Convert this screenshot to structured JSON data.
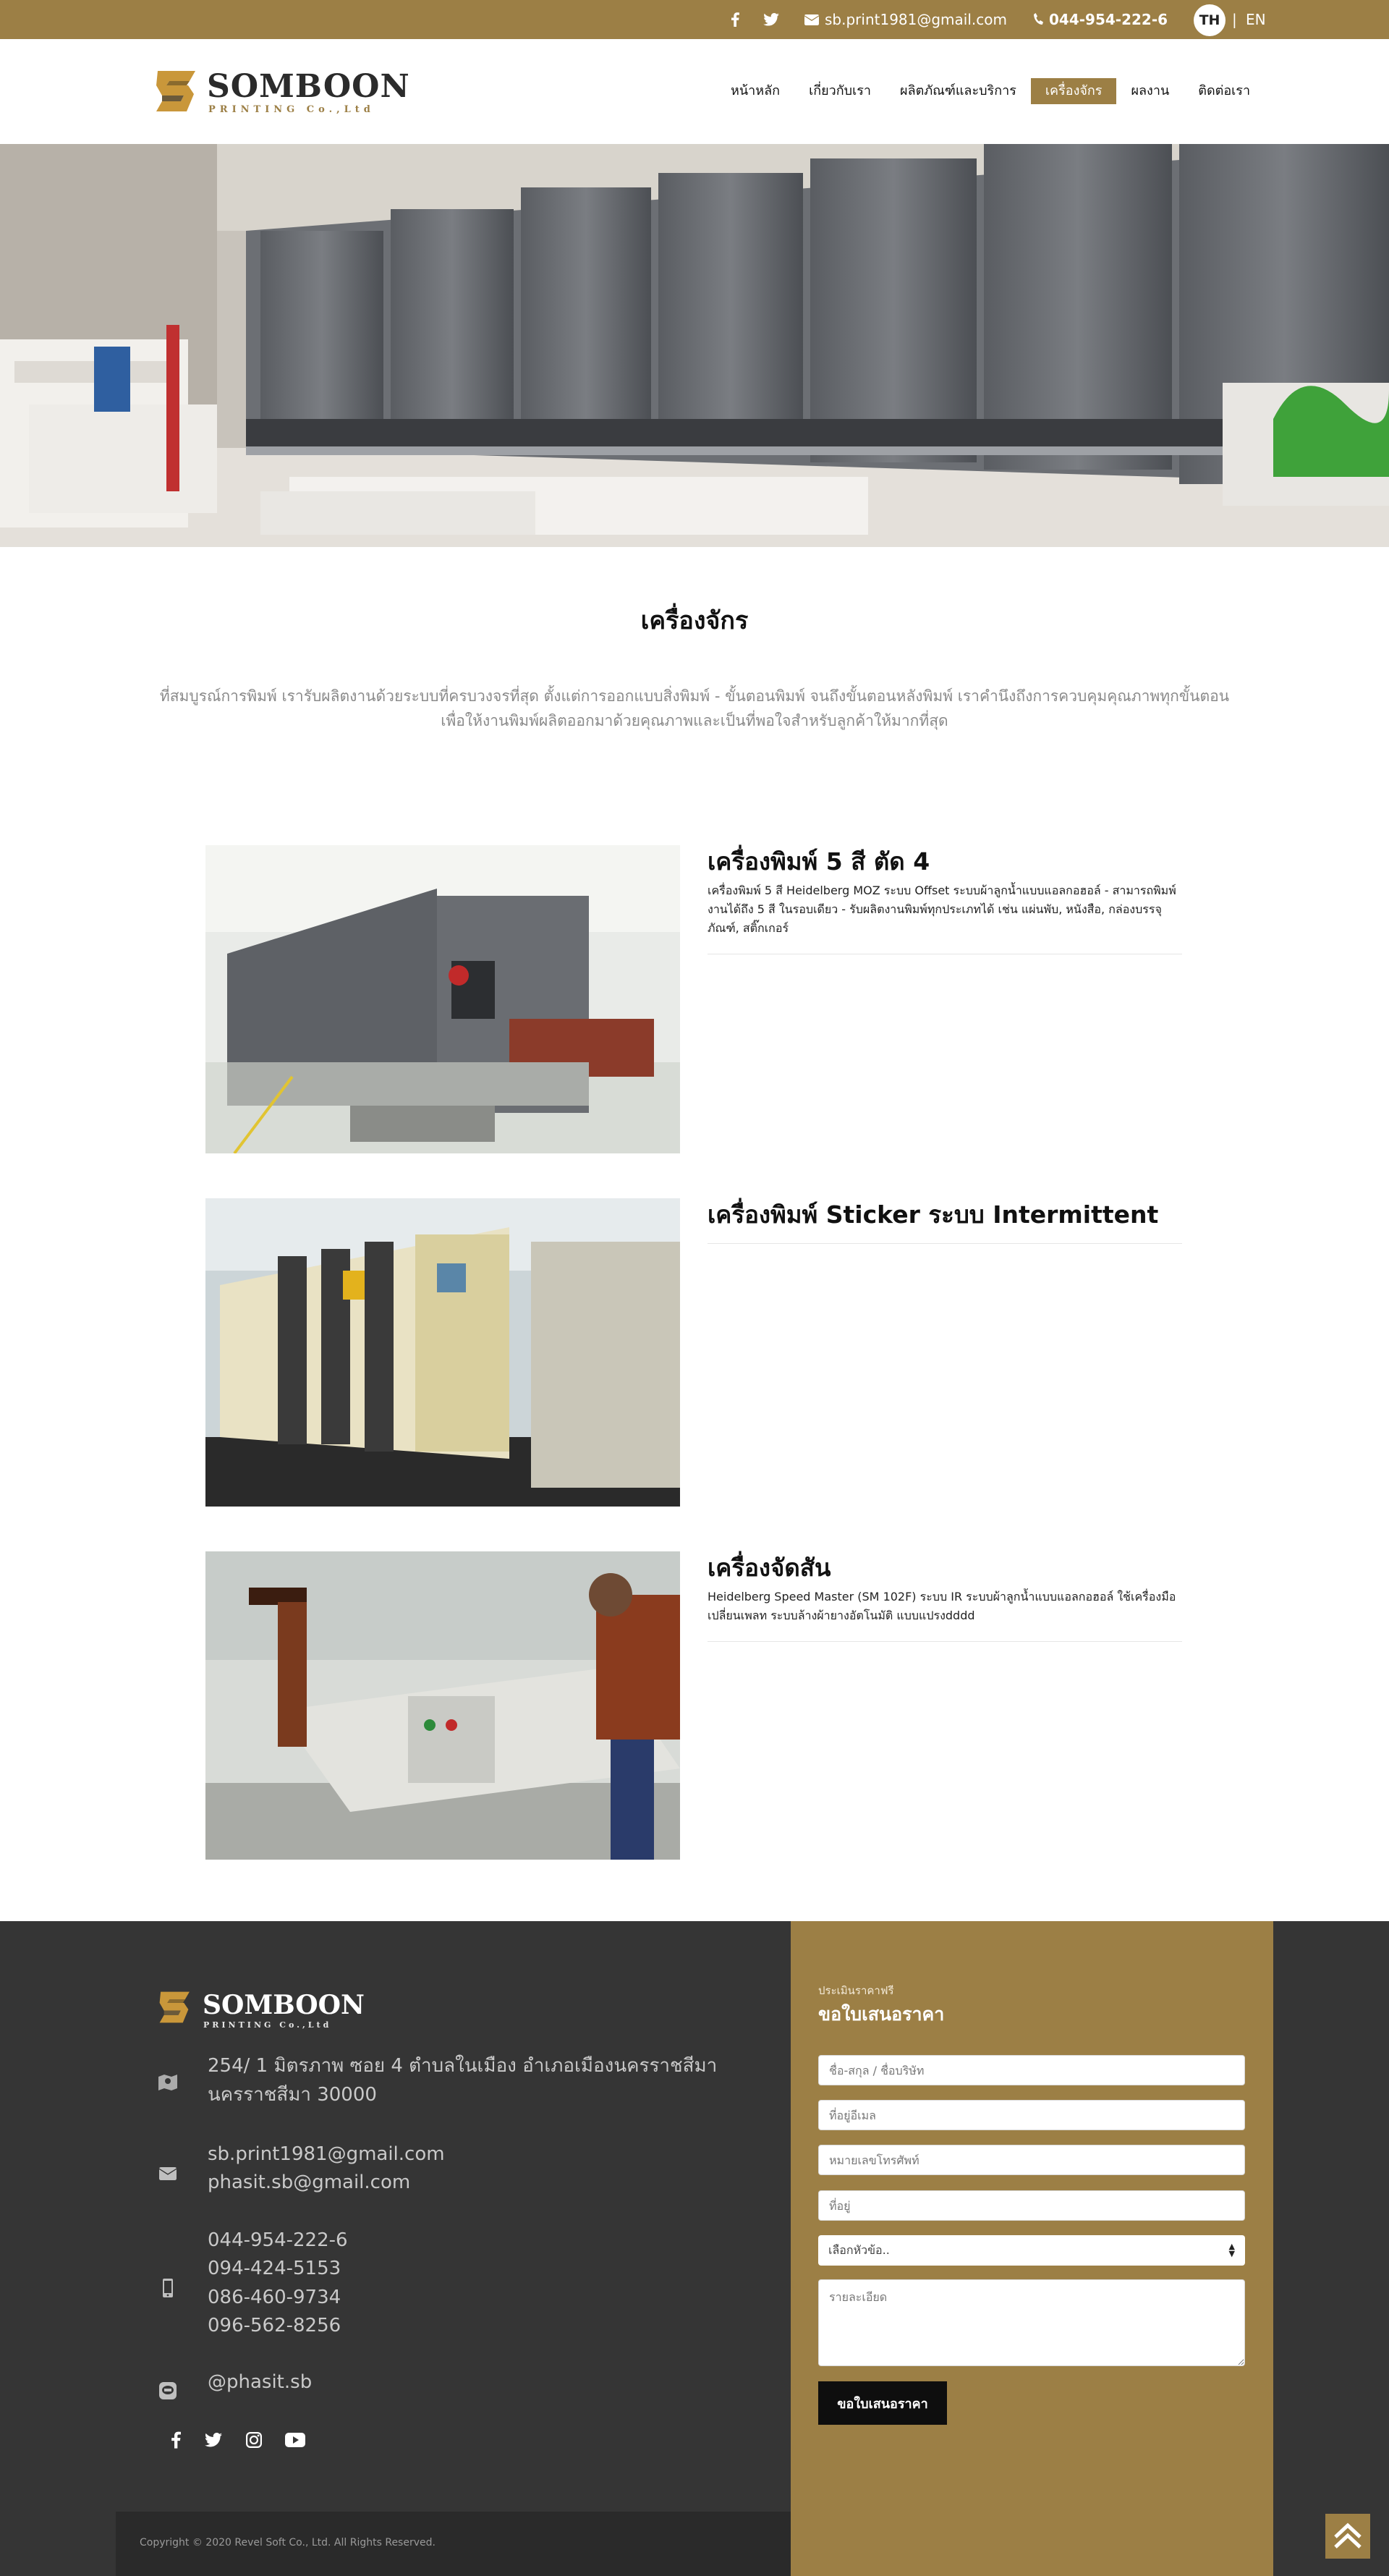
{
  "topbar": {
    "email": "sb.print1981@gmail.com",
    "phone": "044-954-222-6",
    "lang_th": "TH",
    "lang_sep": "|",
    "lang_en": "EN"
  },
  "brand": {
    "name": "SOMBOON",
    "sub": "PRINTING Co.,Ltd"
  },
  "nav": {
    "items": [
      {
        "label": "หน้าหลัก"
      },
      {
        "label": "เกี่ยวกับเรา"
      },
      {
        "label": "ผลิตภัณฑ์และบริการ"
      },
      {
        "label": "เครื่องจักร"
      },
      {
        "label": "ผลงาน"
      },
      {
        "label": "ติดต่อเรา"
      }
    ],
    "active": "เครื่องจักร"
  },
  "section": {
    "title": "เครื่องจักร",
    "description": "ที่สมบูรณ์การพิมพ์ เรารับผลิตงานด้วยระบบที่ครบวงจรที่สุด ตั้งแต่การออกแบบสิ่งพิมพ์ - ขั้นตอนพิมพ์ จนถึงขั้นตอนหลังพิมพ์ เราคำนึงถึงการควบคุมคุณภาพทุกขั้นตอนเพื่อให้งานพิมพ์ผลิตออกมาด้วยคุณภาพและเป็นที่พอใจสำหรับลูกค้าให้มากที่สุด"
  },
  "machines": [
    {
      "title": "เครื่องพิมพ์ 5 สี ตัด 4",
      "description": "เครื่องพิมพ์ 5 สี Heidelberg MOZ ระบบ Offset ระบบผ้าลูกน้ำแบบแอลกอฮอล์ - สามารถพิมพ์งานได้ถึง 5 สี ในรอบเดียว - รับผลิตงานพิมพ์ทุกประเภทได้ เช่น แผ่นพับ, หนังสือ, กล่องบรรจุภัณฑ์, สติ๊กเกอร์"
    },
    {
      "title": "เครื่องพิมพ์ Sticker ระบบ Intermittent",
      "description": ""
    },
    {
      "title": "เครื่องจัดสัน",
      "description": "Heidelberg Speed Master (SM 102F) ระบบ IR ระบบผ้าลูกน้ำแบบแอลกอฮอล์ ใช้เครื่องมือเปลี่ยนเพลท ระบบล้างผ้ายางอัตโนมัติ แบบแปรงdddd"
    }
  ],
  "footer": {
    "address": "254/ 1 มิตรภาพ ซอย 4 ตำบลในเมือง อำเภอเมืองนครราชสีมา นครราชสีมา 30000",
    "emails": [
      "sb.print1981@gmail.com",
      "phasit.sb@gmail.com"
    ],
    "phones": [
      "044-954-222-6",
      "094-424-5153",
      "086-460-9734",
      "096-562-8256"
    ],
    "line": "@phasit.sb",
    "copyright": "Copyright © 2020 Revel Soft Co., Ltd. All Rights Reserved."
  },
  "quote": {
    "eyebrow": "ประเมินราคาฟรี",
    "title": "ขอใบเสนอราคา",
    "name_placeholder": "ชื่อ-สกุล / ชื่อบริษัท",
    "email_placeholder": "ที่อยู่อีเมล",
    "phone_placeholder": "หมายเลขโทรศัพท์",
    "address_placeholder": "ที่อยู่",
    "topic_selected": "เลือกหัวข้อ..",
    "detail_placeholder": "รายละเอียด",
    "submit_label": "ขอใบเสนอราคา"
  },
  "colors": {
    "accent": "#9c7f45",
    "footer_bg": "#353535",
    "footer_bottom": "#2a2a2a"
  },
  "icons": [
    "facebook-icon",
    "twitter-icon",
    "envelope-icon",
    "phone-icon",
    "map-icon",
    "mobile-icon",
    "line-icon",
    "instagram-icon",
    "youtube-icon",
    "scroll-top-icon"
  ]
}
